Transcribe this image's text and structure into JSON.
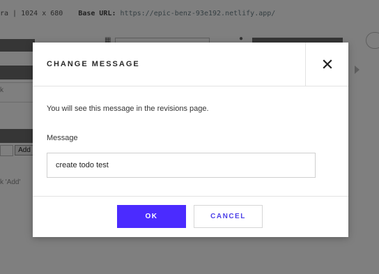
{
  "background": {
    "header": {
      "resolution_text": "ra | 1024 x 680",
      "base_url_label": "Base URL:",
      "base_url_value": "https://epic-benz-93e192.netlify.app/"
    },
    "left_panel": {
      "hint_k": "k",
      "add_button": "Add",
      "hint_add": "k 'Add'"
    },
    "icons": [
      "calendar-icon",
      "user-icon",
      "arrow-right-icon"
    ]
  },
  "modal": {
    "title": "CHANGE MESSAGE",
    "description": "You will see this message in the revisions page.",
    "field_label": "Message",
    "message_value": "create todo test",
    "ok_label": "OK",
    "cancel_label": "CANCEL",
    "accent_color": "#4b2bff"
  }
}
